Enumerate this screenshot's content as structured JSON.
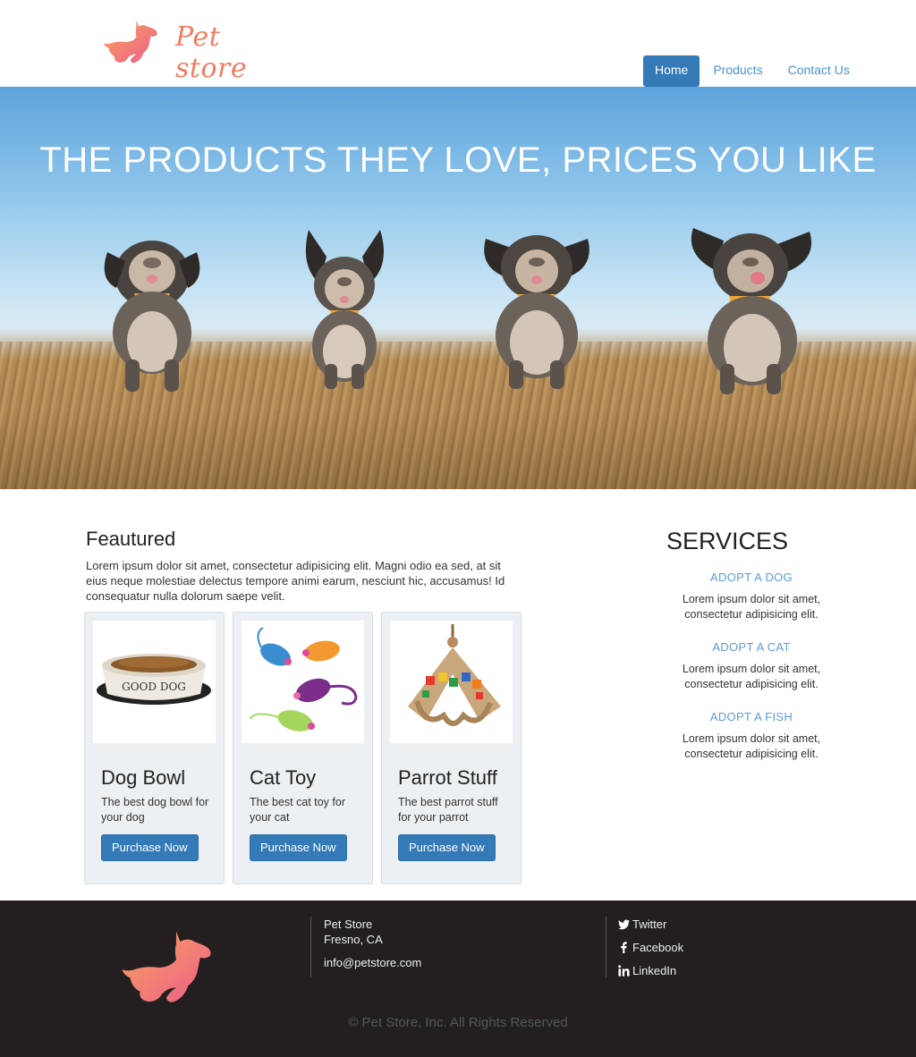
{
  "header": {
    "logo_text": "Pet store",
    "nav": [
      {
        "label": "Home",
        "active": true
      },
      {
        "label": "Products",
        "active": false
      },
      {
        "label": "Contact Us",
        "active": false
      }
    ]
  },
  "hero": {
    "headline": "THE PRODUCTS THEY LOVE, PRICES YOU LIKE"
  },
  "featured": {
    "title": "Feautured",
    "description": "Lorem ipsum dolor sit amet, consectetur adipisicing elit. Magni odio ea sed, at sit eius neque molestiae delectus tempore animi earum, nesciunt hic, accusamus! Id consequatur nulla dolorum saepe velit.",
    "products": [
      {
        "name": "Dog Bowl",
        "description": "The best dog bowl for your dog",
        "button": "Purchase Now",
        "image_label": "GOOD DOG"
      },
      {
        "name": "Cat Toy",
        "description": "The best cat toy for your cat",
        "button": "Purchase Now"
      },
      {
        "name": "Parrot Stuff",
        "description": "The best parrot stuff for your parrot",
        "button": "Purchase Now"
      }
    ]
  },
  "services": {
    "title": "SERVICES",
    "items": [
      {
        "title": "ADOPT A DOG",
        "description": "Lorem ipsum dolor sit amet, consectetur adipisicing elit."
      },
      {
        "title": "ADOPT A CAT",
        "description": "Lorem ipsum dolor sit amet, consectetur adipisicing elit."
      },
      {
        "title": "ADOPT A FISH",
        "description": "Lorem ipsum dolor sit amet, consectetur adipisicing elit."
      }
    ]
  },
  "footer": {
    "company": "Pet Store",
    "location": "Fresno, CA",
    "email": "info@petstore.com",
    "social": [
      {
        "label": "Twitter",
        "icon": "twitter-icon"
      },
      {
        "label": "Facebook",
        "icon": "facebook-icon"
      },
      {
        "label": "LinkedIn",
        "icon": "linkedin-icon"
      }
    ],
    "copyright": "© Pet Store, Inc. All Rights Reserved"
  },
  "colors": {
    "brand": "#f27c5e",
    "primary": "#337ab7",
    "link": "#5b9bd5",
    "footer_bg": "#231f20"
  }
}
